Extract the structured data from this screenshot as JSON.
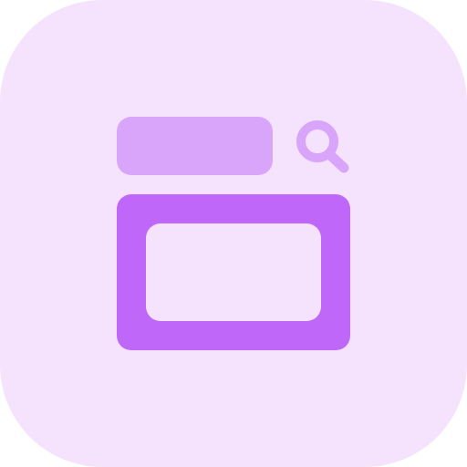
{
  "icon": {
    "name": "search-window-icon",
    "colors": {
      "background": "#F5E3FE",
      "search_bar": "#D9A5FA",
      "search_glyph": "#D9A5FA",
      "window_frame": "#BF67F8",
      "window_content": "#F5E3FE"
    },
    "parts": {
      "search_bar_icon": "search-bar-icon",
      "magnifier_icon": "magnifying-glass-icon",
      "window_icon": "browser-window-icon"
    }
  }
}
